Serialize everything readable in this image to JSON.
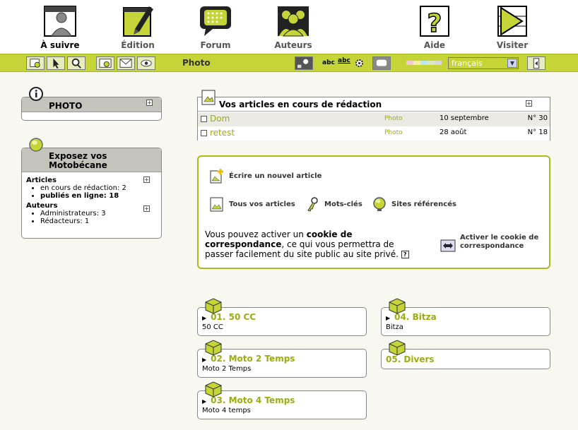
{
  "nav": {
    "items": [
      {
        "label": "À suivre",
        "icon": "user-silhouette-icon"
      },
      {
        "label": "Édition",
        "icon": "pen-document-icon"
      },
      {
        "label": "Forum",
        "icon": "speech-bubble-icon"
      },
      {
        "label": "Auteurs",
        "icon": "group-icon"
      },
      {
        "label": "Aide",
        "icon": "question-mark-icon"
      },
      {
        "label": "Visiter",
        "icon": "arrow-forward-icon"
      }
    ]
  },
  "toolbar": {
    "section_title": "Photo",
    "spell_abc": "abc",
    "spell_abc2": "abc",
    "language": "français",
    "swatches": [
      "#f0c8d8",
      "#f4f0a8",
      "#b8e8f0",
      "#e0e8c0",
      "#d8d8d8"
    ]
  },
  "left": {
    "photo_box": {
      "title": "PHOTO"
    },
    "site_box": {
      "title": "Exposez vos Motobécane",
      "articles_heading": "Articles",
      "articles_items": [
        "en cours de rédaction: 2",
        "publiés en ligne: 18"
      ],
      "authors_heading": "Auteurs",
      "authors_items": [
        "Administrateurs: 3",
        "Rédacteurs: 1"
      ]
    }
  },
  "articles": {
    "heading": "Vos articles en cours de rédaction",
    "rows": [
      {
        "title": "Dom",
        "rubrique": "Photo",
        "date": "10 septembre",
        "num": "N° 30"
      },
      {
        "title": "retest",
        "rubrique": "Photo",
        "date": "28 août",
        "num": "N° 18"
      }
    ]
  },
  "actions": {
    "new_article": "Écrire un nouvel article",
    "all_articles": "Tous vos articles",
    "keywords": "Mots-clés",
    "sites": "Sites référencés",
    "cookie_pre": "Vous pouvez activer un",
    "cookie_bold": "cookie de correspondance",
    "cookie_post": ", ce qui vous permettra de passer facilement du site public au site privé.",
    "cookie_help": "?",
    "cookie_button": "Activer le cookie de correspondance"
  },
  "rubriques": [
    {
      "title": "01. 50 CC",
      "desc": "50 CC"
    },
    {
      "title": "02. Moto 2 Temps",
      "desc": "Moto 2 Temps"
    },
    {
      "title": "03. Moto 4 Temps",
      "desc": "Moto 4 temps"
    },
    {
      "title": "04. Bitza",
      "desc": "Bitza"
    },
    {
      "title": "05. Divers",
      "desc": ""
    }
  ],
  "colors": {
    "accent": "#c5d436",
    "link": "#9aae10",
    "border_green": "#a8bc1c"
  }
}
